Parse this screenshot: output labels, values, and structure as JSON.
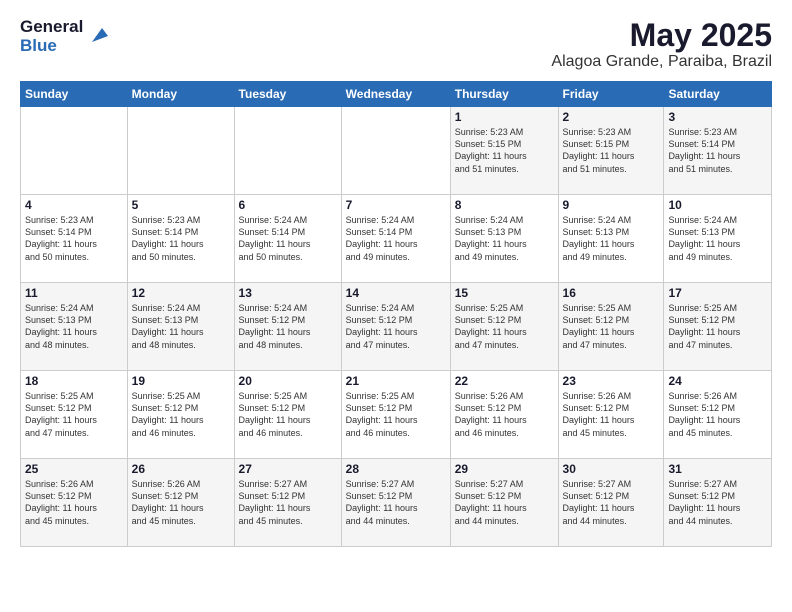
{
  "header": {
    "logo_general": "General",
    "logo_blue": "Blue",
    "title": "May 2025",
    "subtitle": "Alagoa Grande, Paraiba, Brazil"
  },
  "calendar": {
    "days_of_week": [
      "Sunday",
      "Monday",
      "Tuesday",
      "Wednesday",
      "Thursday",
      "Friday",
      "Saturday"
    ],
    "weeks": [
      [
        {
          "day": "",
          "info": ""
        },
        {
          "day": "",
          "info": ""
        },
        {
          "day": "",
          "info": ""
        },
        {
          "day": "",
          "info": ""
        },
        {
          "day": "1",
          "info": "Sunrise: 5:23 AM\nSunset: 5:15 PM\nDaylight: 11 hours\nand 51 minutes."
        },
        {
          "day": "2",
          "info": "Sunrise: 5:23 AM\nSunset: 5:15 PM\nDaylight: 11 hours\nand 51 minutes."
        },
        {
          "day": "3",
          "info": "Sunrise: 5:23 AM\nSunset: 5:14 PM\nDaylight: 11 hours\nand 51 minutes."
        }
      ],
      [
        {
          "day": "4",
          "info": "Sunrise: 5:23 AM\nSunset: 5:14 PM\nDaylight: 11 hours\nand 50 minutes."
        },
        {
          "day": "5",
          "info": "Sunrise: 5:23 AM\nSunset: 5:14 PM\nDaylight: 11 hours\nand 50 minutes."
        },
        {
          "day": "6",
          "info": "Sunrise: 5:24 AM\nSunset: 5:14 PM\nDaylight: 11 hours\nand 50 minutes."
        },
        {
          "day": "7",
          "info": "Sunrise: 5:24 AM\nSunset: 5:14 PM\nDaylight: 11 hours\nand 49 minutes."
        },
        {
          "day": "8",
          "info": "Sunrise: 5:24 AM\nSunset: 5:13 PM\nDaylight: 11 hours\nand 49 minutes."
        },
        {
          "day": "9",
          "info": "Sunrise: 5:24 AM\nSunset: 5:13 PM\nDaylight: 11 hours\nand 49 minutes."
        },
        {
          "day": "10",
          "info": "Sunrise: 5:24 AM\nSunset: 5:13 PM\nDaylight: 11 hours\nand 49 minutes."
        }
      ],
      [
        {
          "day": "11",
          "info": "Sunrise: 5:24 AM\nSunset: 5:13 PM\nDaylight: 11 hours\nand 48 minutes."
        },
        {
          "day": "12",
          "info": "Sunrise: 5:24 AM\nSunset: 5:13 PM\nDaylight: 11 hours\nand 48 minutes."
        },
        {
          "day": "13",
          "info": "Sunrise: 5:24 AM\nSunset: 5:12 PM\nDaylight: 11 hours\nand 48 minutes."
        },
        {
          "day": "14",
          "info": "Sunrise: 5:24 AM\nSunset: 5:12 PM\nDaylight: 11 hours\nand 47 minutes."
        },
        {
          "day": "15",
          "info": "Sunrise: 5:25 AM\nSunset: 5:12 PM\nDaylight: 11 hours\nand 47 minutes."
        },
        {
          "day": "16",
          "info": "Sunrise: 5:25 AM\nSunset: 5:12 PM\nDaylight: 11 hours\nand 47 minutes."
        },
        {
          "day": "17",
          "info": "Sunrise: 5:25 AM\nSunset: 5:12 PM\nDaylight: 11 hours\nand 47 minutes."
        }
      ],
      [
        {
          "day": "18",
          "info": "Sunrise: 5:25 AM\nSunset: 5:12 PM\nDaylight: 11 hours\nand 47 minutes."
        },
        {
          "day": "19",
          "info": "Sunrise: 5:25 AM\nSunset: 5:12 PM\nDaylight: 11 hours\nand 46 minutes."
        },
        {
          "day": "20",
          "info": "Sunrise: 5:25 AM\nSunset: 5:12 PM\nDaylight: 11 hours\nand 46 minutes."
        },
        {
          "day": "21",
          "info": "Sunrise: 5:25 AM\nSunset: 5:12 PM\nDaylight: 11 hours\nand 46 minutes."
        },
        {
          "day": "22",
          "info": "Sunrise: 5:26 AM\nSunset: 5:12 PM\nDaylight: 11 hours\nand 46 minutes."
        },
        {
          "day": "23",
          "info": "Sunrise: 5:26 AM\nSunset: 5:12 PM\nDaylight: 11 hours\nand 45 minutes."
        },
        {
          "day": "24",
          "info": "Sunrise: 5:26 AM\nSunset: 5:12 PM\nDaylight: 11 hours\nand 45 minutes."
        }
      ],
      [
        {
          "day": "25",
          "info": "Sunrise: 5:26 AM\nSunset: 5:12 PM\nDaylight: 11 hours\nand 45 minutes."
        },
        {
          "day": "26",
          "info": "Sunrise: 5:26 AM\nSunset: 5:12 PM\nDaylight: 11 hours\nand 45 minutes."
        },
        {
          "day": "27",
          "info": "Sunrise: 5:27 AM\nSunset: 5:12 PM\nDaylight: 11 hours\nand 45 minutes."
        },
        {
          "day": "28",
          "info": "Sunrise: 5:27 AM\nSunset: 5:12 PM\nDaylight: 11 hours\nand 44 minutes."
        },
        {
          "day": "29",
          "info": "Sunrise: 5:27 AM\nSunset: 5:12 PM\nDaylight: 11 hours\nand 44 minutes."
        },
        {
          "day": "30",
          "info": "Sunrise: 5:27 AM\nSunset: 5:12 PM\nDaylight: 11 hours\nand 44 minutes."
        },
        {
          "day": "31",
          "info": "Sunrise: 5:27 AM\nSunset: 5:12 PM\nDaylight: 11 hours\nand 44 minutes."
        }
      ]
    ]
  }
}
